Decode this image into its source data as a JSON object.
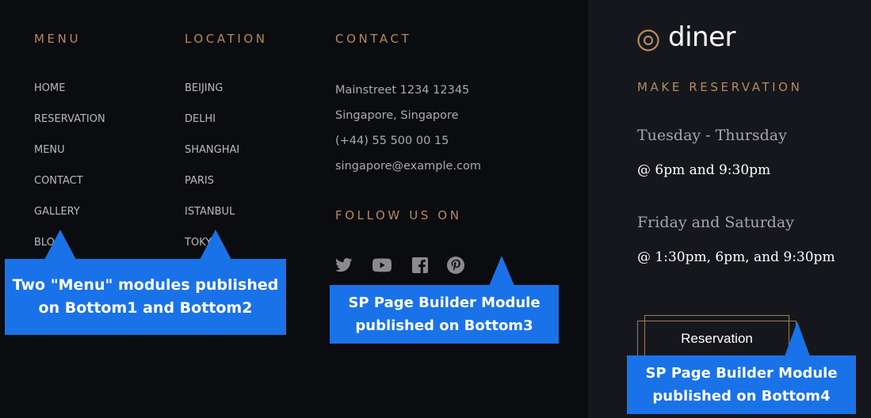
{
  "menu": {
    "heading": "MENU",
    "items": [
      "HOME",
      "RESERVATION",
      "MENU",
      "CONTACT",
      "GALLERY",
      "BLOG"
    ]
  },
  "location": {
    "heading": "LOCATION",
    "items": [
      "BEIJING",
      "DELHI",
      "SHANGHAI",
      "PARIS",
      "ISTANBUL",
      "TOKYO"
    ]
  },
  "contact": {
    "heading": "CONTACT",
    "address1": "Mainstreet 1234 12345",
    "address2": "Singapore, Singapore",
    "phone": "(+44) 55 500 00 15",
    "email": "singapore@example.com",
    "follow_heading": "FOLLOW US ON",
    "social_icons": [
      "twitter-icon",
      "youtube-icon",
      "facebook-icon",
      "pinterest-icon"
    ]
  },
  "reservation": {
    "logo_text": "diner",
    "heading": "MAKE RESERVATION",
    "days1": "Tuesday - Thursday",
    "times1": "@ 6pm and 9:30pm",
    "days2": "Friday and Saturday",
    "times2": "@ 1:30pm, 6pm, and 9:30pm",
    "button_label": "Reservation"
  },
  "callouts": {
    "menu_modules": [
      "Two \"Menu\" modules published",
      "on Bottom1 and Bottom2"
    ],
    "bottom3": [
      "SP Page Builder  Module",
      "published on Bottom3"
    ],
    "bottom4": [
      "SP Page Builder  Module",
      "published on Bottom4"
    ]
  },
  "colors": {
    "background": "#0b0c10",
    "panel": "#16171c",
    "accent_gold": "#b38a5e",
    "callout_blue": "#1a72e8"
  }
}
